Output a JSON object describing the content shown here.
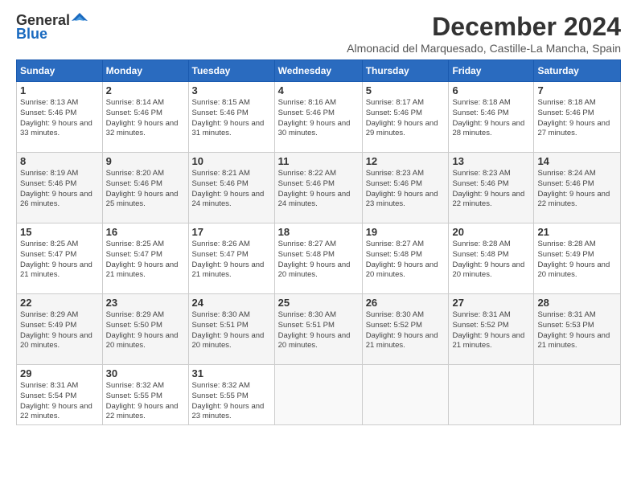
{
  "header": {
    "logo_general": "General",
    "logo_blue": "Blue",
    "month_title": "December 2024",
    "location": "Almonacid del Marquesado, Castille-La Mancha, Spain"
  },
  "days_of_week": [
    "Sunday",
    "Monday",
    "Tuesday",
    "Wednesday",
    "Thursday",
    "Friday",
    "Saturday"
  ],
  "weeks": [
    [
      {
        "day": "1",
        "sunrise": "Sunrise: 8:13 AM",
        "sunset": "Sunset: 5:46 PM",
        "daylight": "Daylight: 9 hours and 33 minutes."
      },
      {
        "day": "2",
        "sunrise": "Sunrise: 8:14 AM",
        "sunset": "Sunset: 5:46 PM",
        "daylight": "Daylight: 9 hours and 32 minutes."
      },
      {
        "day": "3",
        "sunrise": "Sunrise: 8:15 AM",
        "sunset": "Sunset: 5:46 PM",
        "daylight": "Daylight: 9 hours and 31 minutes."
      },
      {
        "day": "4",
        "sunrise": "Sunrise: 8:16 AM",
        "sunset": "Sunset: 5:46 PM",
        "daylight": "Daylight: 9 hours and 30 minutes."
      },
      {
        "day": "5",
        "sunrise": "Sunrise: 8:17 AM",
        "sunset": "Sunset: 5:46 PM",
        "daylight": "Daylight: 9 hours and 29 minutes."
      },
      {
        "day": "6",
        "sunrise": "Sunrise: 8:18 AM",
        "sunset": "Sunset: 5:46 PM",
        "daylight": "Daylight: 9 hours and 28 minutes."
      },
      {
        "day": "7",
        "sunrise": "Sunrise: 8:18 AM",
        "sunset": "Sunset: 5:46 PM",
        "daylight": "Daylight: 9 hours and 27 minutes."
      }
    ],
    [
      {
        "day": "8",
        "sunrise": "Sunrise: 8:19 AM",
        "sunset": "Sunset: 5:46 PM",
        "daylight": "Daylight: 9 hours and 26 minutes."
      },
      {
        "day": "9",
        "sunrise": "Sunrise: 8:20 AM",
        "sunset": "Sunset: 5:46 PM",
        "daylight": "Daylight: 9 hours and 25 minutes."
      },
      {
        "day": "10",
        "sunrise": "Sunrise: 8:21 AM",
        "sunset": "Sunset: 5:46 PM",
        "daylight": "Daylight: 9 hours and 24 minutes."
      },
      {
        "day": "11",
        "sunrise": "Sunrise: 8:22 AM",
        "sunset": "Sunset: 5:46 PM",
        "daylight": "Daylight: 9 hours and 24 minutes."
      },
      {
        "day": "12",
        "sunrise": "Sunrise: 8:23 AM",
        "sunset": "Sunset: 5:46 PM",
        "daylight": "Daylight: 9 hours and 23 minutes."
      },
      {
        "day": "13",
        "sunrise": "Sunrise: 8:23 AM",
        "sunset": "Sunset: 5:46 PM",
        "daylight": "Daylight: 9 hours and 22 minutes."
      },
      {
        "day": "14",
        "sunrise": "Sunrise: 8:24 AM",
        "sunset": "Sunset: 5:46 PM",
        "daylight": "Daylight: 9 hours and 22 minutes."
      }
    ],
    [
      {
        "day": "15",
        "sunrise": "Sunrise: 8:25 AM",
        "sunset": "Sunset: 5:47 PM",
        "daylight": "Daylight: 9 hours and 21 minutes."
      },
      {
        "day": "16",
        "sunrise": "Sunrise: 8:25 AM",
        "sunset": "Sunset: 5:47 PM",
        "daylight": "Daylight: 9 hours and 21 minutes."
      },
      {
        "day": "17",
        "sunrise": "Sunrise: 8:26 AM",
        "sunset": "Sunset: 5:47 PM",
        "daylight": "Daylight: 9 hours and 21 minutes."
      },
      {
        "day": "18",
        "sunrise": "Sunrise: 8:27 AM",
        "sunset": "Sunset: 5:48 PM",
        "daylight": "Daylight: 9 hours and 20 minutes."
      },
      {
        "day": "19",
        "sunrise": "Sunrise: 8:27 AM",
        "sunset": "Sunset: 5:48 PM",
        "daylight": "Daylight: 9 hours and 20 minutes."
      },
      {
        "day": "20",
        "sunrise": "Sunrise: 8:28 AM",
        "sunset": "Sunset: 5:48 PM",
        "daylight": "Daylight: 9 hours and 20 minutes."
      },
      {
        "day": "21",
        "sunrise": "Sunrise: 8:28 AM",
        "sunset": "Sunset: 5:49 PM",
        "daylight": "Daylight: 9 hours and 20 minutes."
      }
    ],
    [
      {
        "day": "22",
        "sunrise": "Sunrise: 8:29 AM",
        "sunset": "Sunset: 5:49 PM",
        "daylight": "Daylight: 9 hours and 20 minutes."
      },
      {
        "day": "23",
        "sunrise": "Sunrise: 8:29 AM",
        "sunset": "Sunset: 5:50 PM",
        "daylight": "Daylight: 9 hours and 20 minutes."
      },
      {
        "day": "24",
        "sunrise": "Sunrise: 8:30 AM",
        "sunset": "Sunset: 5:51 PM",
        "daylight": "Daylight: 9 hours and 20 minutes."
      },
      {
        "day": "25",
        "sunrise": "Sunrise: 8:30 AM",
        "sunset": "Sunset: 5:51 PM",
        "daylight": "Daylight: 9 hours and 20 minutes."
      },
      {
        "day": "26",
        "sunrise": "Sunrise: 8:30 AM",
        "sunset": "Sunset: 5:52 PM",
        "daylight": "Daylight: 9 hours and 21 minutes."
      },
      {
        "day": "27",
        "sunrise": "Sunrise: 8:31 AM",
        "sunset": "Sunset: 5:52 PM",
        "daylight": "Daylight: 9 hours and 21 minutes."
      },
      {
        "day": "28",
        "sunrise": "Sunrise: 8:31 AM",
        "sunset": "Sunset: 5:53 PM",
        "daylight": "Daylight: 9 hours and 21 minutes."
      }
    ],
    [
      {
        "day": "29",
        "sunrise": "Sunrise: 8:31 AM",
        "sunset": "Sunset: 5:54 PM",
        "daylight": "Daylight: 9 hours and 22 minutes."
      },
      {
        "day": "30",
        "sunrise": "Sunrise: 8:32 AM",
        "sunset": "Sunset: 5:55 PM",
        "daylight": "Daylight: 9 hours and 22 minutes."
      },
      {
        "day": "31",
        "sunrise": "Sunrise: 8:32 AM",
        "sunset": "Sunset: 5:55 PM",
        "daylight": "Daylight: 9 hours and 23 minutes."
      },
      null,
      null,
      null,
      null
    ]
  ]
}
